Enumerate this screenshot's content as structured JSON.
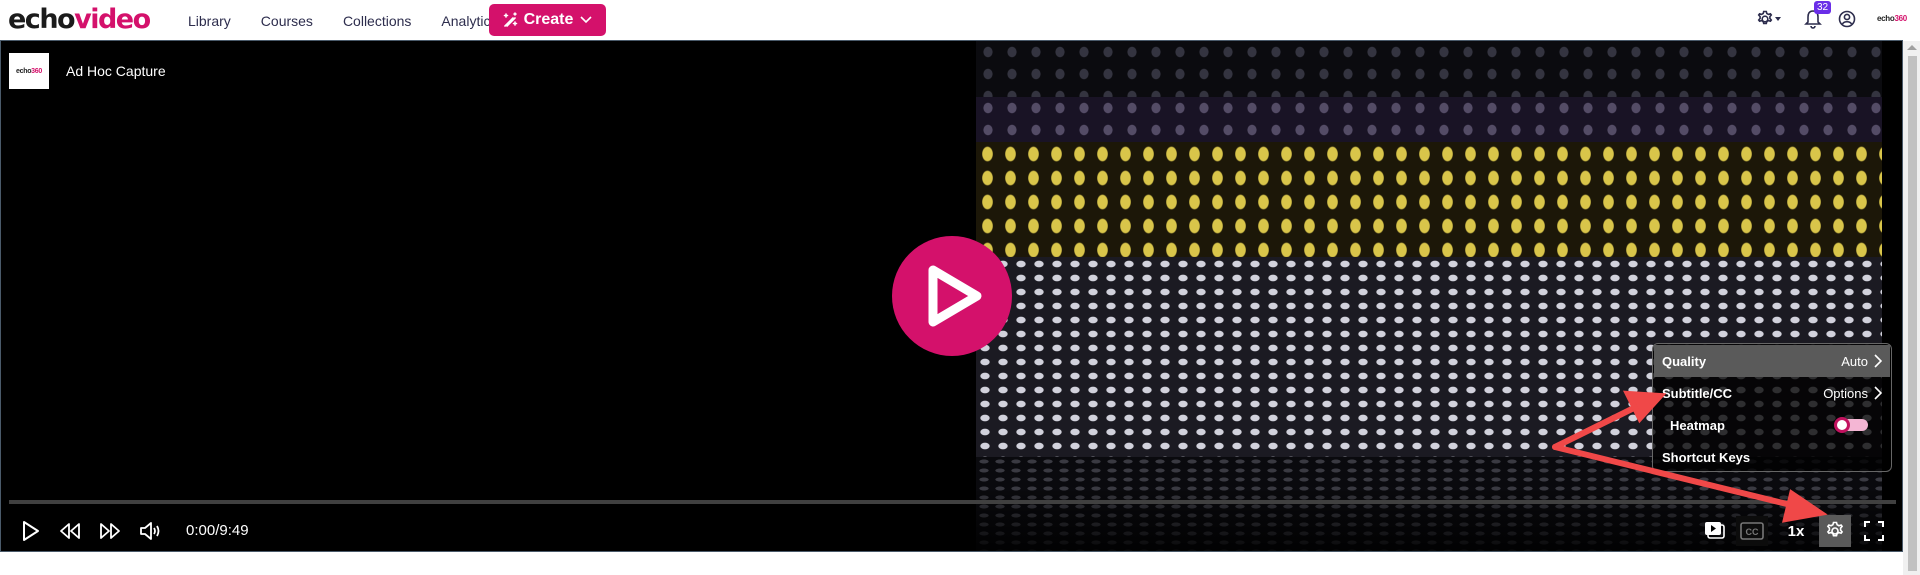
{
  "header": {
    "logo": {
      "part1": "echo",
      "part2": "video"
    },
    "nav": [
      {
        "label": "Library"
      },
      {
        "label": "Courses"
      },
      {
        "label": "Collections"
      },
      {
        "label": "Analytics"
      }
    ],
    "create_label": "Create",
    "notification_count": "32",
    "brand": {
      "part1": "echo",
      "part2": "360"
    }
  },
  "player": {
    "title": "Ad Hoc Capture",
    "thumb_brand": {
      "part1": "echo",
      "part2": "360"
    },
    "time": "0:00/9:49",
    "progress": 0,
    "speed": "1x",
    "settings_menu": {
      "items": [
        {
          "label": "Quality",
          "value": "Auto"
        },
        {
          "label": "Subtitle/CC",
          "value": "Options"
        },
        {
          "label": "Heatmap",
          "toggle": false
        },
        {
          "label": "Shortcut Keys"
        }
      ]
    }
  },
  "colors": {
    "brand": "#d4116b",
    "badge": "#6a2ee8",
    "annotation_arrow": "#f04848"
  }
}
